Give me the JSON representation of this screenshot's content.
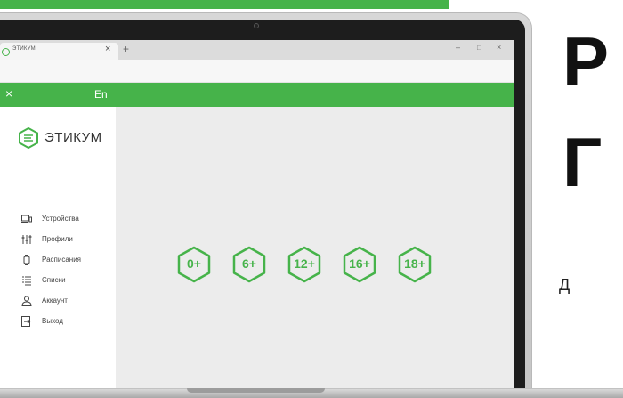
{
  "browser": {
    "tab_title": "ЭТИКУМ",
    "tab_close": "×",
    "new_tab": "+",
    "minimize": "–",
    "maximize": "□",
    "close": "×"
  },
  "appbar": {
    "close_icon": "×",
    "language": "En",
    "accent_color": "#46b34a"
  },
  "sidebar": {
    "logo_text": "ЭТИКУМ",
    "items": [
      {
        "label": "Устройства",
        "icon": "devices-icon"
      },
      {
        "label": "Профили",
        "icon": "sliders-icon"
      },
      {
        "label": "Расписания",
        "icon": "watch-icon"
      },
      {
        "label": "Списки",
        "icon": "list-icon"
      },
      {
        "label": "Аккаунт",
        "icon": "user-icon"
      },
      {
        "label": "Выход",
        "icon": "logout-icon"
      }
    ]
  },
  "age_ratings": [
    {
      "label": "0+"
    },
    {
      "label": "6+"
    },
    {
      "label": "12+"
    },
    {
      "label": "16+"
    },
    {
      "label": "18+"
    }
  ],
  "side_text": {
    "line1": "Р",
    "line2": "Г",
    "line3": "Д"
  }
}
